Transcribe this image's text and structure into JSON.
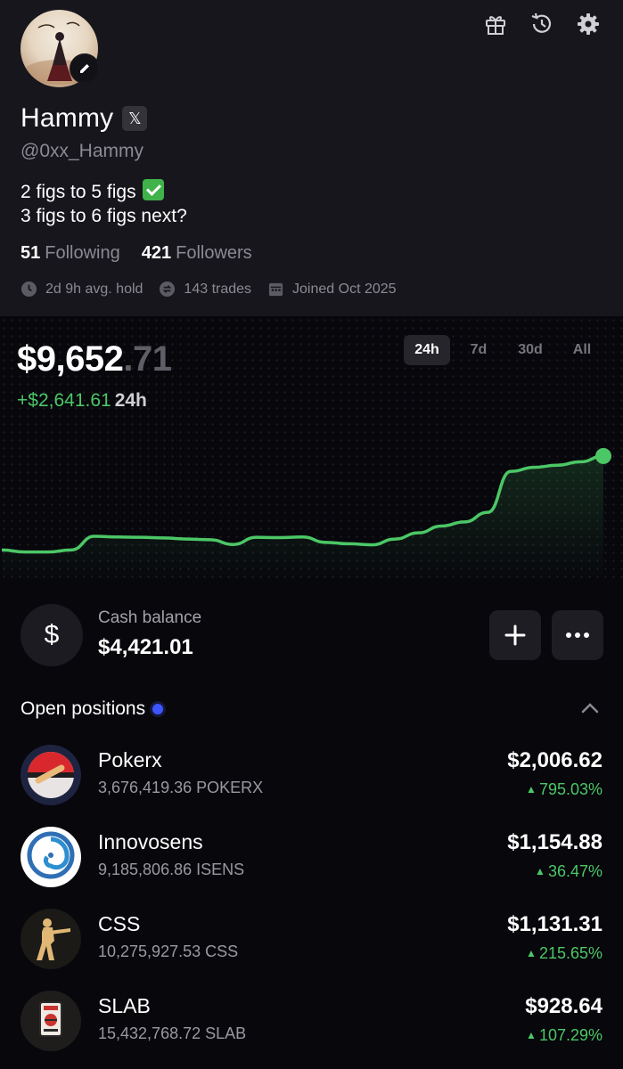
{
  "profile": {
    "name": "Hammy",
    "x_badge": "𝕏",
    "handle": "@0xx_Hammy",
    "bio_line1": "2 figs to 5 figs",
    "bio_line2": "3 figs to 6 figs next?",
    "following_count": "51",
    "following_label": "Following",
    "followers_count": "421",
    "followers_label": "Followers",
    "avg_hold": "2d 9h avg. hold",
    "trades": "143 trades",
    "joined": "Joined Oct 2025"
  },
  "portfolio": {
    "balance_main": "$9,652",
    "balance_cents": ".71",
    "change": "+$2,641.61",
    "change_period": "24h",
    "ranges": [
      "24h",
      "7d",
      "30d",
      "All"
    ],
    "active_range": "24h",
    "accent_color": "#4cc766"
  },
  "chart_data": {
    "type": "line",
    "series": [
      {
        "values": [
          6.9,
          6.84,
          6.84,
          6.9,
          7.3,
          7.28,
          7.27,
          7.25,
          7.22,
          7.2,
          7.06,
          7.27,
          7.26,
          7.28,
          7.12,
          7.08,
          7.05,
          7.22,
          7.4,
          7.6,
          7.72,
          8.0,
          9.2,
          9.32,
          9.38,
          9.48,
          9.65
        ]
      }
    ],
    "grid": false,
    "color": "#4cc766"
  },
  "cash": {
    "icon": "dollar-icon",
    "label": "Cash balance",
    "value": "$4,421.01",
    "add_icon": "plus-icon",
    "more_icon": "more-icon"
  },
  "positions": {
    "title": "Open positions",
    "items": [
      {
        "name": "Pokerx",
        "amount": "3,676,419.36 POKERX",
        "value": "$2,006.62",
        "change": "795.03%",
        "icon": "pokerx-logo-icon"
      },
      {
        "name": "Innovosens",
        "amount": "9,185,806.86 ISENS",
        "value": "$1,154.88",
        "change": "36.47%",
        "icon": "innovosens-logo-icon"
      },
      {
        "name": "CSS",
        "amount": "10,275,927.53 CSS",
        "value": "$1,131.31",
        "change": "215.65%",
        "icon": "css-soldier-icon"
      },
      {
        "name": "SLAB",
        "amount": "15,432,768.72 SLAB",
        "value": "$928.64",
        "change": "107.29%",
        "icon": "slab-card-icon"
      }
    ]
  }
}
